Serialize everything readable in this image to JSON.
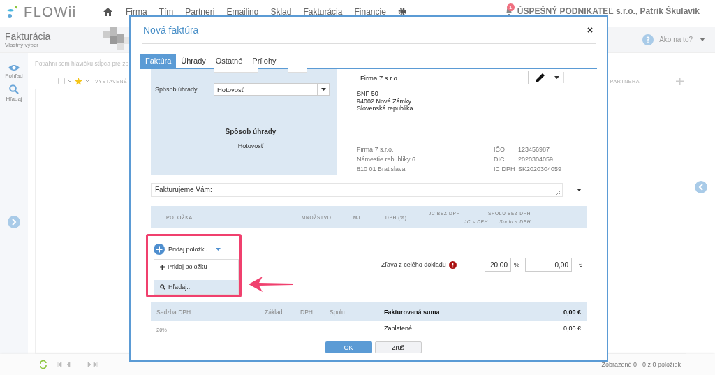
{
  "app": {
    "logo": "FLOWii",
    "nav": [
      "Firma",
      "Tím",
      "Partneri",
      "Emailing",
      "Sklad",
      "Fakturácia",
      "Financie"
    ],
    "notification_count": "1",
    "account": "ÚSPEŠNÝ PODNIKATEĽ s.r.o., Patrik Škulavík"
  },
  "page": {
    "title": "Fakturácia",
    "subtitle": "Vlastný výber",
    "help": "Ako na to?"
  },
  "sidebar": [
    {
      "label": "Pohľad",
      "kind": "view"
    },
    {
      "label": "Hľadaj",
      "kind": "search"
    }
  ],
  "grid": {
    "select_all_checked": false,
    "group_hint": "Potiahni sem hlavičku stĺpca pre zo",
    "columns": [
      "VYSTAVENÉ",
      "PARTNERA"
    ]
  },
  "footer": {
    "status": "Zobrazené 0 - 0 z 0 položiek"
  },
  "modal": {
    "title": "Nová faktúra",
    "tabs": [
      {
        "label": "Faktúra",
        "selected": true
      },
      {
        "label": "Úhrady",
        "selected": false
      },
      {
        "label": "Ostatné",
        "selected": false
      },
      {
        "label": "Prílohy",
        "selected": false
      }
    ],
    "payment": {
      "label": "Spôsob úhrady",
      "value": "Hotovosť",
      "heading": "Spôsob úhrady",
      "summary": "Hotovosť"
    },
    "customer": {
      "value": "Firma 7 s.r.o.",
      "address": [
        "SNP 50",
        "94002 Nové Zámky",
        "Slovenská republika"
      ]
    },
    "supplier": {
      "lines": [
        "Firma 7 s.r.o.",
        "Námestie rebubliky 6",
        "810 01 Bratislava"
      ],
      "ids": [
        {
          "label": "IČO",
          "value": "123456987"
        },
        {
          "label": "DIČ",
          "value": "2020304059"
        },
        {
          "label": "IČ DPH",
          "value": "SK2020304059"
        }
      ]
    },
    "intro_text": "Fakturujeme Vám:",
    "item_columns": [
      {
        "top": "POLOŽKA"
      },
      {
        "top": "MNOŽSTVO"
      },
      {
        "top": "MJ"
      },
      {
        "top": "DPH (%)"
      },
      {
        "top": "JC BEZ DPH",
        "bottom": "JC s DPH"
      },
      {
        "top": "SPOLU BEZ DPH",
        "bottom": "Spolu s DPH"
      }
    ],
    "add_button": "Pridaj položku",
    "add_menu": [
      {
        "label": "Pridaj položku",
        "kind": "add",
        "selected": false
      },
      {
        "label": "Hľadaj...",
        "kind": "search",
        "selected": true
      }
    ],
    "discount": {
      "label": "Zľava z celého dokladu",
      "percent": "20,00",
      "percent_unit": "%",
      "amount": "0,00",
      "currency": "€"
    },
    "vat_columns": [
      "Sadzba DPH",
      "Základ",
      "DPH",
      "Spolu"
    ],
    "vat_rows": [
      {
        "rate": "20%"
      }
    ],
    "totals": [
      {
        "label": "Fakturovaná suma",
        "value": "0,00 €",
        "kind": "main"
      },
      {
        "label": "Zaplatené",
        "value": "0,00 €",
        "kind": "paid"
      }
    ],
    "buttons": [
      {
        "label": "OK",
        "kind": "primary"
      },
      {
        "label": "Zruš",
        "kind": "secondary"
      }
    ]
  }
}
